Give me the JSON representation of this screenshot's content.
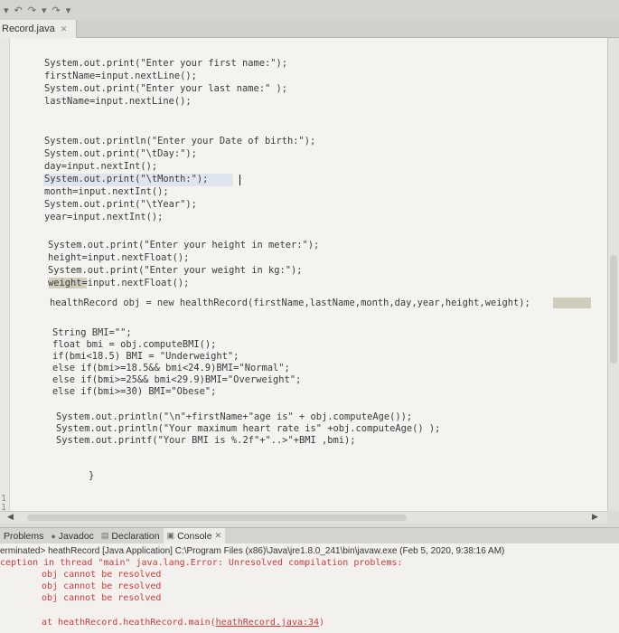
{
  "toolbar": {
    "icons": [
      "dropdown-arrow-icon",
      "back-icon",
      "forward-icon",
      "dropdown-arrow-icon",
      "forward-icon",
      "dropdown-arrow-icon"
    ]
  },
  "editor_tab": {
    "label": "Record.java",
    "close": "✕"
  },
  "gutter": {
    "numbers": [
      "1",
      "1"
    ]
  },
  "code": [
    "System.out.print(\"Enter your first name:\");",
    "firstName=input.nextLine();",
    "System.out.print(\"Enter your last name:\" );",
    "lastName=input.nextLine();",
    "System.out.println(\"Enter your Date of birth:\");",
    "System.out.print(\"\\tDay:\");",
    "day=input.nextInt();",
    "System.out.print(\"\\tMonth:\");",
    "month=input.nextInt();",
    "System.out.print(\"\\tYear\");",
    "year=input.nextInt();",
    "System.out.print(\"Enter your height in meter:\");",
    "height=input.nextFloat();",
    "System.out.print(\"Enter your weight in kg:\");",
    "weight=input.nextFloat();",
    "healthRecord obj = new healthRecord(firstName,lastName,month,day,year,height,weight);",
    "String BMI=\"\";",
    "float bmi = obj.computeBMI();",
    "if(bmi<18.5) BMI = \"Underweight\";",
    "else if(bmi>=18.5&& bmi<24.9)BMI=\"Normal\";",
    "else if(bmi>=25&& bmi<29.9)BMI=\"Overweight\";",
    "else if(bmi>=30) BMI=\"Obese\";",
    "System.out.println(\"\\n\"+firstName+\"age is\" + obj.computeAge());",
    "System.out.println(\"Your maximum heart rate is\" +obj.computeAge() );",
    "System.out.printf(\"Your BMI is %.2f\"+\"..>\"+BMI ,bmi);",
    "}"
  ],
  "console_tabs": [
    {
      "label": "Problems",
      "icon": "problems-icon"
    },
    {
      "label": "Javadoc",
      "icon": "javadoc-icon"
    },
    {
      "label": "Declaration",
      "icon": "declaration-icon"
    },
    {
      "label": "Console",
      "icon": "console-icon",
      "close": "✕"
    }
  ],
  "console": {
    "status": "erminated> heathRecord [Java Application] C:\\Program Files (x86)\\Java\\jre1.8.0_241\\bin\\javaw.exe (Feb 5, 2020, 9:38:16 AM)",
    "lines": [
      "ception in thread \"main\" java.lang.Error: Unresolved compilation problems:",
      "obj cannot be resolved",
      "obj cannot be resolved",
      "obj cannot be resolved"
    ],
    "trace_prefix": "at heathRecord.heathRecord.main(",
    "trace_link": "heathRecord.java:34",
    "trace_suffix": ")"
  }
}
